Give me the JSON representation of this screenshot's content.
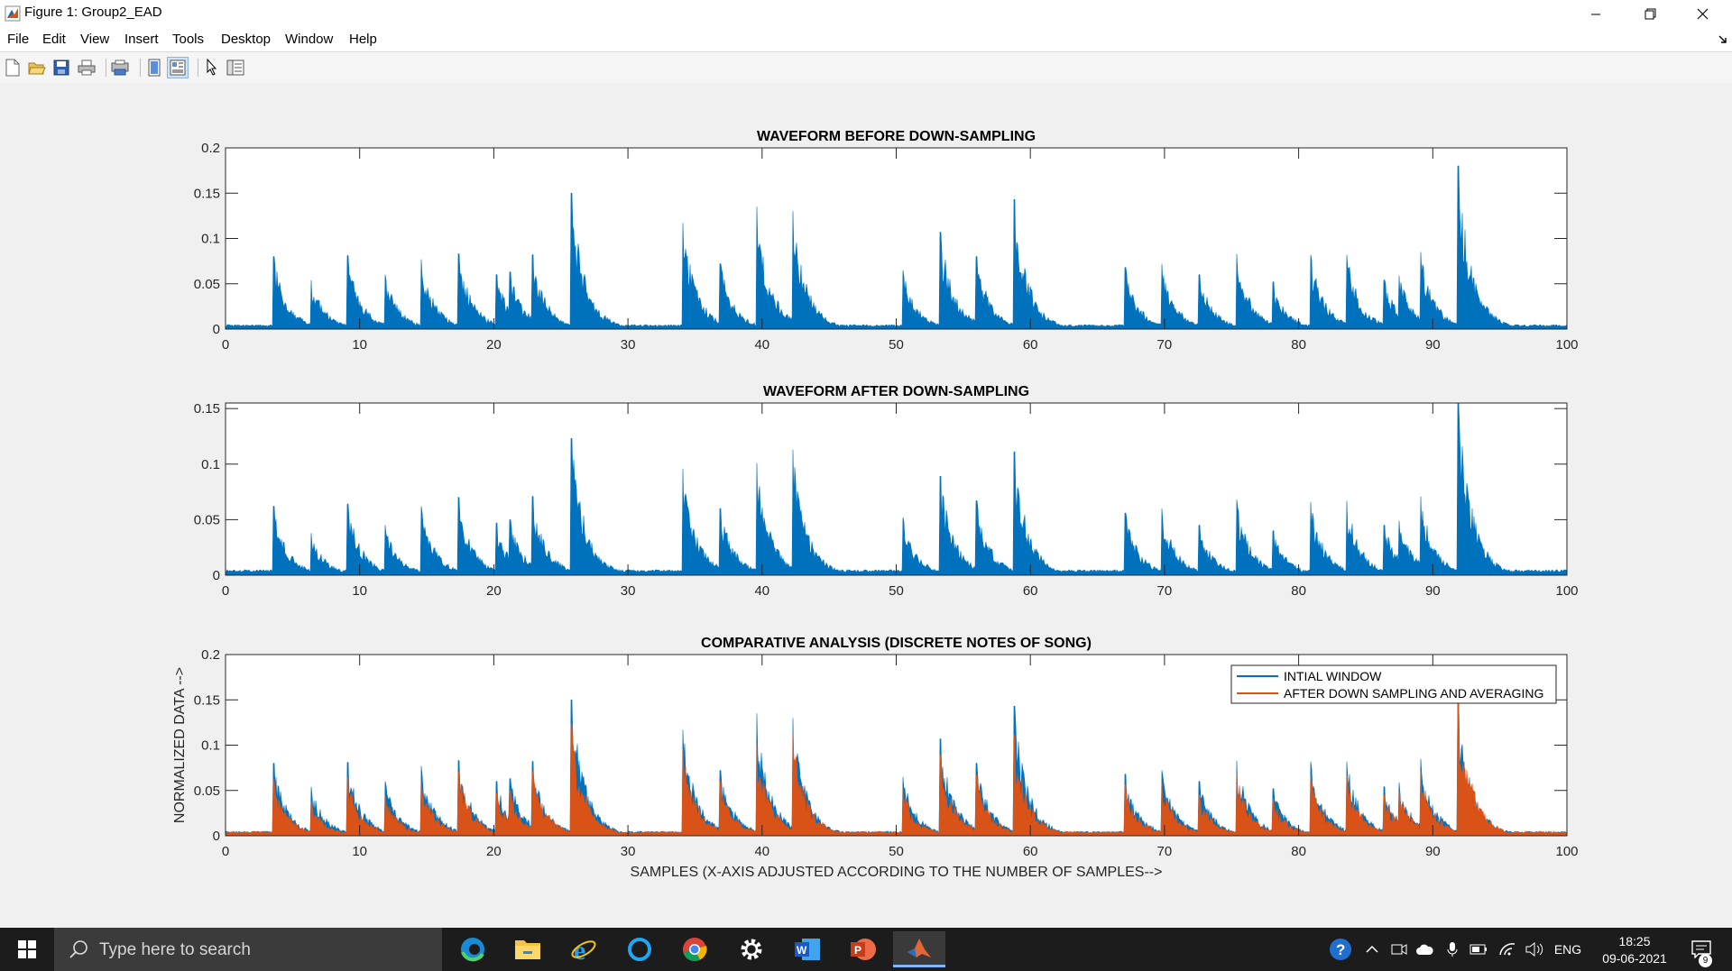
{
  "window": {
    "title": "Figure 1: Group2_EAD"
  },
  "menu": [
    "File",
    "Edit",
    "View",
    "Insert",
    "Tools",
    "Desktop",
    "Window",
    "Help"
  ],
  "toolbar_icons": [
    "new-figure-icon",
    "open-file-icon",
    "save-icon",
    "print-icon",
    "print-preview-icon",
    "hide-plot-tools-icon",
    "show-plot-tools-icon",
    "edit-plot-icon",
    "open-property-inspector-icon"
  ],
  "colors": {
    "blue": "#0072bd",
    "orange": "#d95319"
  },
  "chart_data": [
    {
      "type": "area",
      "title": "WAVEFORM BEFORE DOWN-SAMPLING",
      "xlabel": "",
      "ylabel": "",
      "xlim": [
        0,
        100
      ],
      "ylim": [
        0,
        0.2
      ],
      "xticks": [
        "0",
        "10",
        "20",
        "30",
        "40",
        "50",
        "60",
        "70",
        "80",
        "90",
        "100"
      ],
      "yticks": [
        "0",
        "0.05",
        "0.1",
        "0.15",
        "0.2"
      ],
      "series": [
        {
          "color": "#0072bd",
          "x": [
            3.6,
            6.4,
            9.1,
            11.9,
            14.6,
            17.4,
            20.2,
            21.2,
            22.9,
            25.8,
            34.1,
            36.9,
            39.6,
            42.3,
            50.5,
            53.3,
            56.0,
            58.8,
            67.1,
            69.8,
            72.6,
            75.4,
            78.1,
            80.9,
            83.6,
            86.4,
            87.5,
            89.1,
            91.9
          ],
          "values": [
            0.08,
            0.054,
            0.081,
            0.06,
            0.077,
            0.083,
            0.06,
            0.063,
            0.082,
            0.15,
            0.117,
            0.072,
            0.135,
            0.13,
            0.065,
            0.107,
            0.08,
            0.143,
            0.068,
            0.072,
            0.06,
            0.083,
            0.052,
            0.082,
            0.082,
            0.054,
            0.059,
            0.085,
            0.18
          ]
        }
      ]
    },
    {
      "type": "area",
      "title": "WAVEFORM AFTER DOWN-SAMPLING",
      "xlabel": "",
      "ylabel": "",
      "xlim": [
        0,
        100
      ],
      "ylim": [
        0,
        0.155
      ],
      "xticks": [
        "0",
        "10",
        "20",
        "30",
        "40",
        "50",
        "60",
        "70",
        "80",
        "90",
        "100"
      ],
      "yticks": [
        "0",
        "0.05",
        "0.1",
        "0.15"
      ],
      "series": [
        {
          "color": "#0072bd",
          "x": [
            3.6,
            6.4,
            9.1,
            11.9,
            14.6,
            17.4,
            20.2,
            21.2,
            22.9,
            25.8,
            34.1,
            36.9,
            39.6,
            42.3,
            50.5,
            53.3,
            56.0,
            58.8,
            67.1,
            69.8,
            72.6,
            75.4,
            78.1,
            80.9,
            83.6,
            86.4,
            87.5,
            89.1,
            91.9
          ],
          "values": [
            0.062,
            0.038,
            0.064,
            0.045,
            0.062,
            0.07,
            0.047,
            0.05,
            0.071,
            0.123,
            0.096,
            0.06,
            0.101,
            0.113,
            0.052,
            0.089,
            0.067,
            0.111,
            0.056,
            0.06,
            0.045,
            0.068,
            0.04,
            0.066,
            0.067,
            0.045,
            0.049,
            0.071,
            0.155
          ]
        }
      ]
    },
    {
      "type": "area",
      "title": "COMPARATIVE ANALYSIS (DISCRETE NOTES OF SONG)",
      "xlabel": "SAMPLES (X-AXIS ADJUSTED ACCORDING TO THE NUMBER OF SAMPLES-->",
      "ylabel": "NORMALIZED DATA -->",
      "xlim": [
        0,
        100
      ],
      "ylim": [
        0,
        0.2
      ],
      "xticks": [
        "0",
        "10",
        "20",
        "30",
        "40",
        "50",
        "60",
        "70",
        "80",
        "90",
        "100"
      ],
      "yticks": [
        "0",
        "0.05",
        "0.1",
        "0.15",
        "0.2"
      ],
      "legend": {
        "position": "top-right",
        "entries": [
          "INTIAL WINDOW",
          "AFTER DOWN SAMPLING AND AVERAGING"
        ]
      },
      "series": [
        {
          "name": "INTIAL WINDOW",
          "color": "#0072bd",
          "x": [
            3.6,
            6.4,
            9.1,
            11.9,
            14.6,
            17.4,
            20.2,
            21.2,
            22.9,
            25.8,
            34.1,
            36.9,
            39.6,
            42.3,
            50.5,
            53.3,
            56.0,
            58.8,
            67.1,
            69.8,
            72.6,
            75.4,
            78.1,
            80.9,
            83.6,
            86.4,
            87.5,
            89.1,
            91.9
          ],
          "values": [
            0.08,
            0.054,
            0.081,
            0.06,
            0.077,
            0.083,
            0.06,
            0.063,
            0.082,
            0.15,
            0.117,
            0.072,
            0.135,
            0.13,
            0.065,
            0.107,
            0.08,
            0.143,
            0.068,
            0.072,
            0.06,
            0.083,
            0.052,
            0.082,
            0.082,
            0.054,
            0.059,
            0.085,
            0.15
          ]
        },
        {
          "name": "AFTER DOWN SAMPLING AND AVERAGING",
          "color": "#d95319",
          "x": [
            3.6,
            6.4,
            9.1,
            11.9,
            14.6,
            17.4,
            20.2,
            21.2,
            22.9,
            25.8,
            34.1,
            36.9,
            39.6,
            42.3,
            50.5,
            53.3,
            56.0,
            58.8,
            67.1,
            69.8,
            72.6,
            75.4,
            78.1,
            80.9,
            83.6,
            86.4,
            87.5,
            89.1,
            91.9
          ],
          "values": [
            0.062,
            0.038,
            0.064,
            0.045,
            0.062,
            0.07,
            0.047,
            0.05,
            0.071,
            0.123,
            0.096,
            0.06,
            0.101,
            0.113,
            0.052,
            0.089,
            0.067,
            0.111,
            0.056,
            0.06,
            0.045,
            0.068,
            0.04,
            0.066,
            0.067,
            0.045,
            0.049,
            0.071,
            0.155
          ]
        }
      ]
    }
  ],
  "taskbar": {
    "search_placeholder": "Type here to search",
    "apps": [
      "edge-icon",
      "file-explorer-icon",
      "internet-explorer-icon",
      "cortana-icon",
      "chrome-icon",
      "settings-icon",
      "word-icon",
      "powerpoint-icon",
      "matlab-icon"
    ],
    "language": "ENG",
    "time": "18:25",
    "date": "09-06-2021",
    "notification_count": "9"
  }
}
